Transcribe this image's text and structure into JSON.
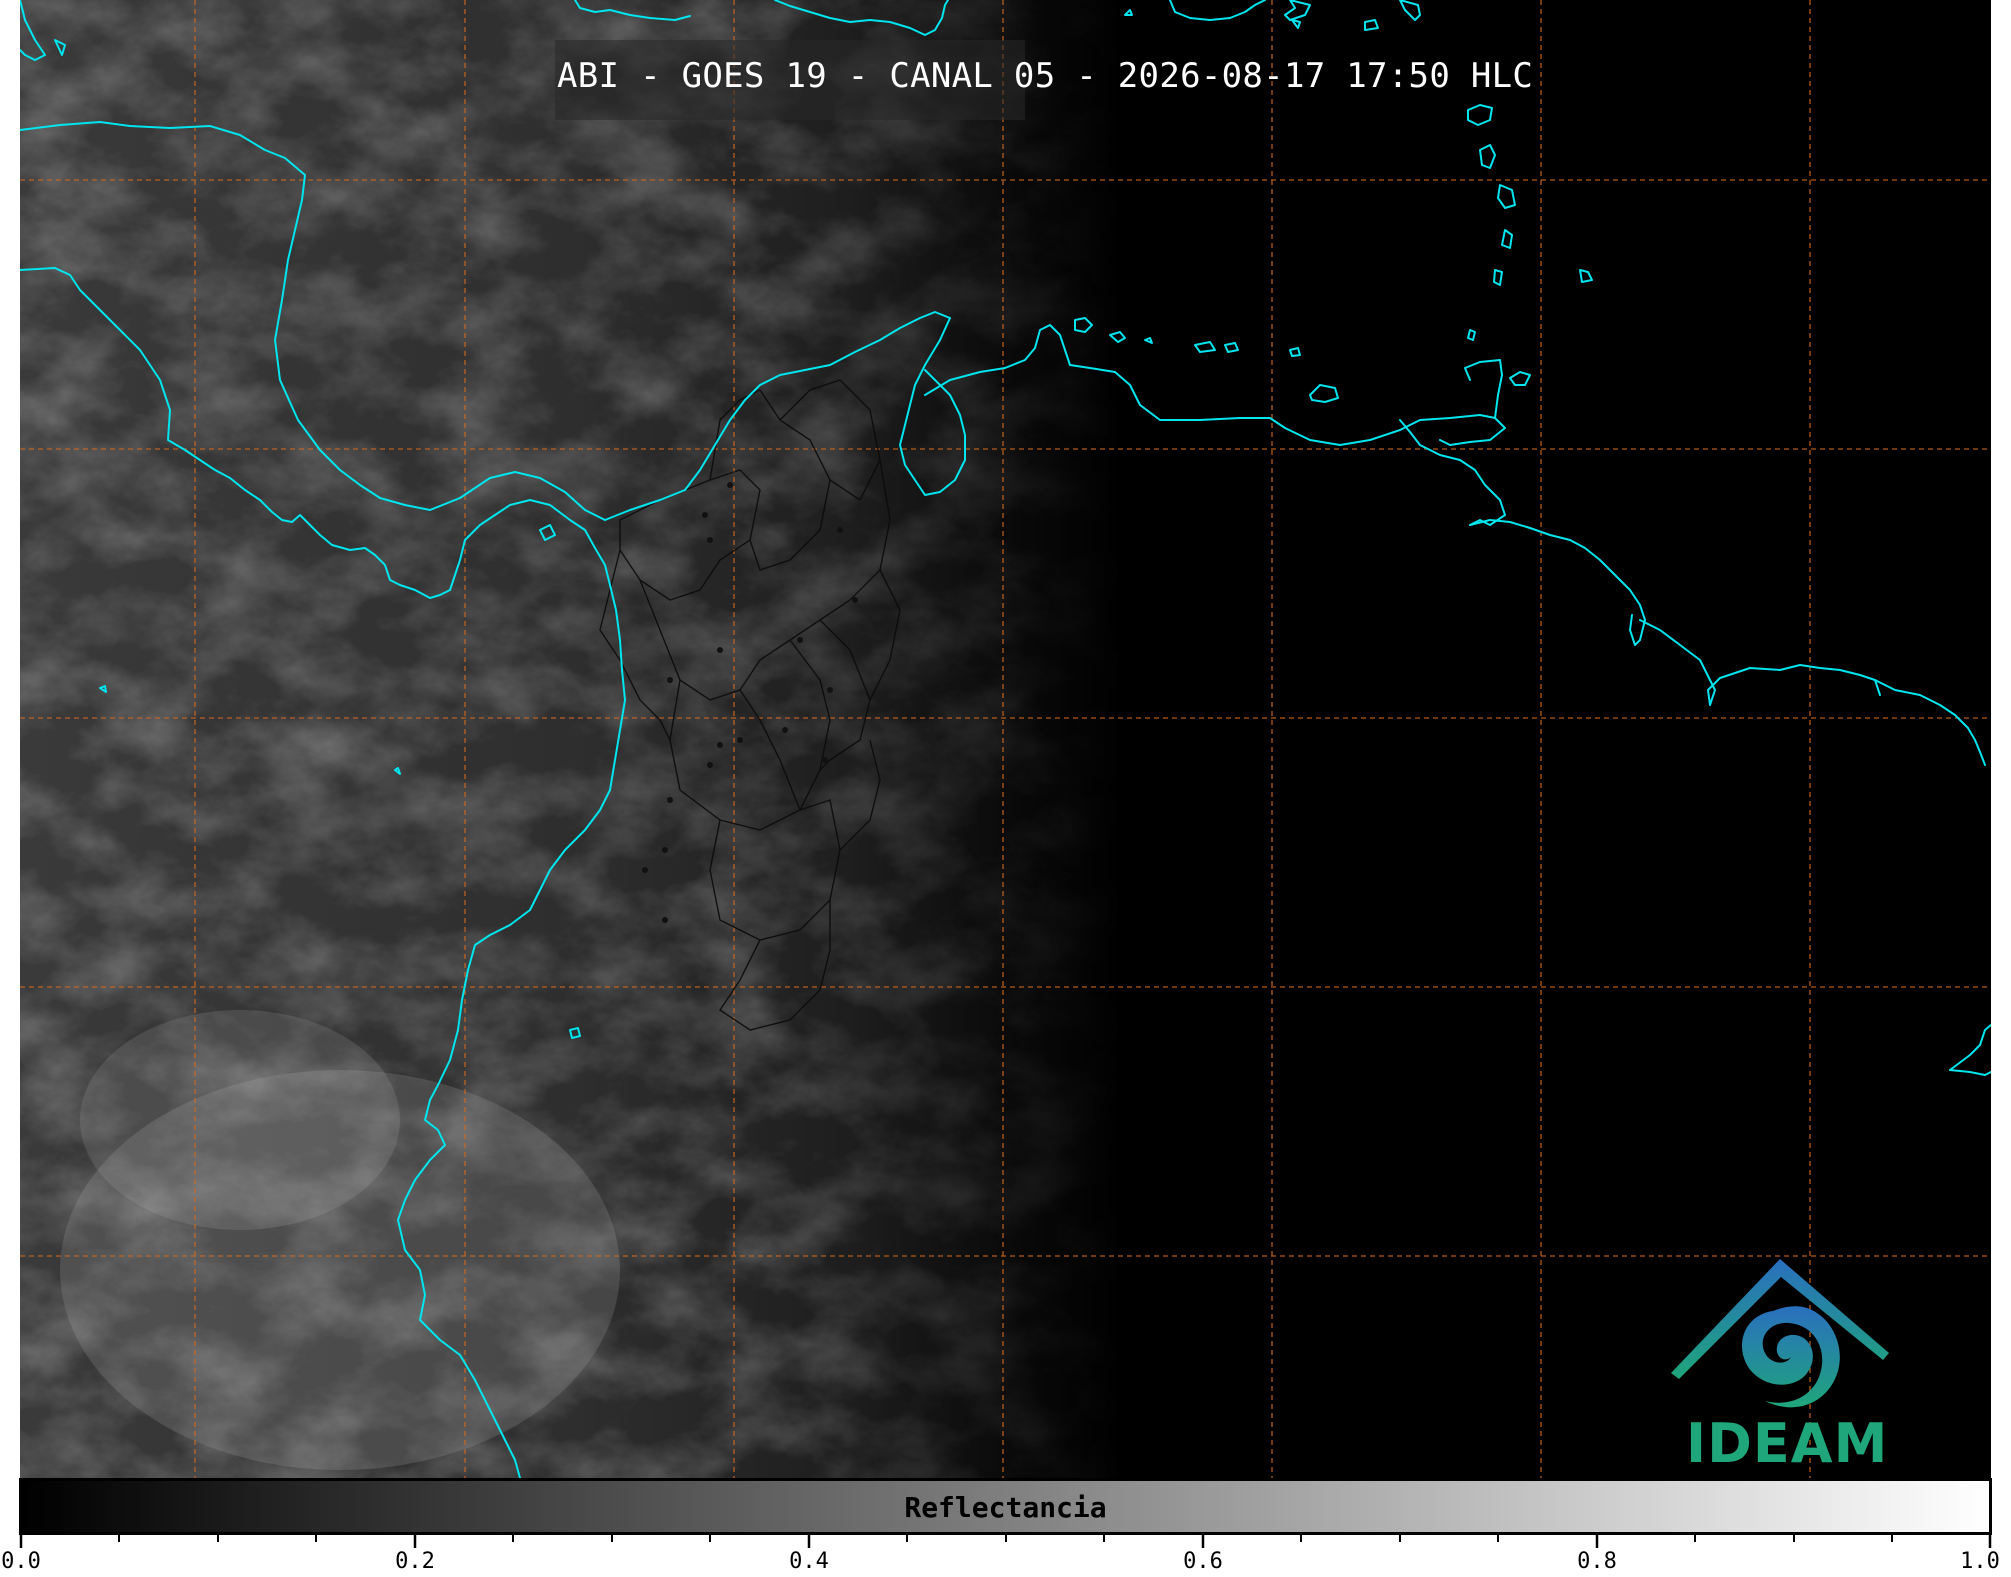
{
  "map": {
    "title": "ABI - GOES 19 - CANAL 05 - 2026-08-17 17:50 HLC",
    "coastline_color": "#00e5ee",
    "border_color": "#000000",
    "grid_color": "#d2691e"
  },
  "logo": {
    "text": "IDEAM",
    "colors": [
      "#2a6fbf",
      "#1fa67a"
    ]
  },
  "colorbar": {
    "label": "Reflectancia",
    "min": 0.0,
    "max": 1.0,
    "colormap": "grayscale",
    "ticks": [
      "0.0",
      "0.2",
      "0.4",
      "0.6",
      "0.8",
      "1.0"
    ]
  }
}
